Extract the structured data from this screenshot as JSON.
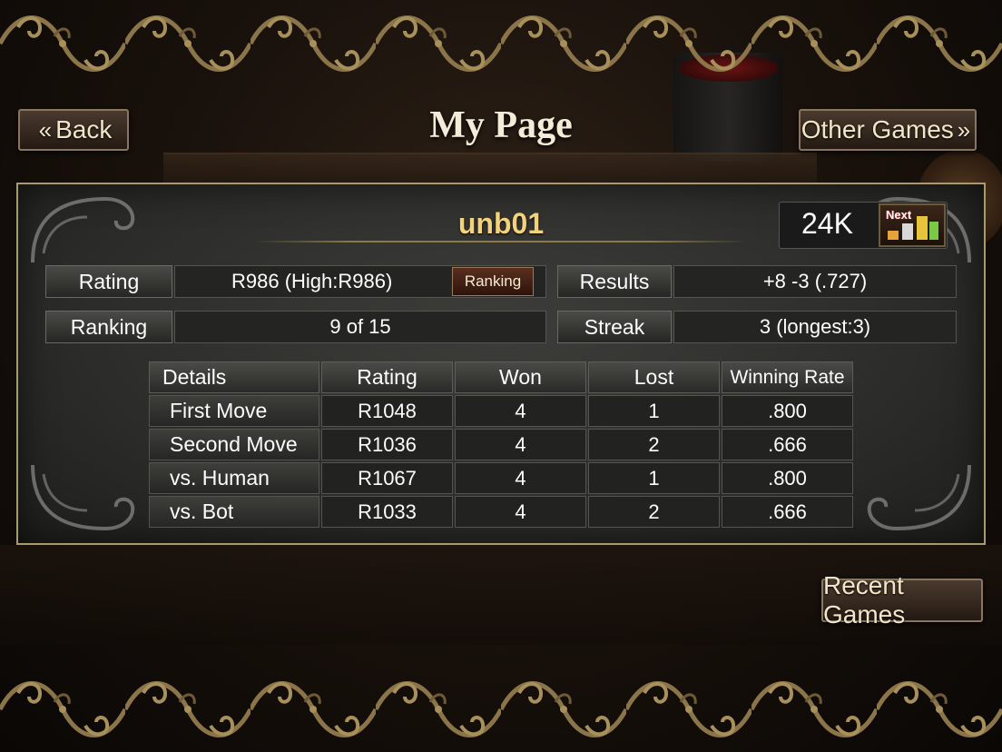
{
  "header": {
    "title": "My Page",
    "back_label": "Back",
    "other_games_label": "Other Games"
  },
  "profile": {
    "username": "unb01",
    "grade": "24K",
    "next_label": "Next"
  },
  "stats": {
    "rating_label": "Rating",
    "rating_value": "R986 (High:R986)",
    "ranking_button": "Ranking",
    "results_label": "Results",
    "results_value": "+8 -3 (.727)",
    "ranking_label": "Ranking",
    "ranking_value": "9 of 15",
    "streak_label": "Streak",
    "streak_value": "3 (longest:3)"
  },
  "details": {
    "headers": [
      "Details",
      "Rating",
      "Won",
      "Lost",
      "Winning Rate"
    ],
    "rows": [
      {
        "label": "First Move",
        "rating": "R1048",
        "won": "4",
        "lost": "1",
        "rate": ".800"
      },
      {
        "label": "Second Move",
        "rating": "R1036",
        "won": "4",
        "lost": "2",
        "rate": ".666"
      },
      {
        "label": "vs. Human",
        "rating": "R1067",
        "won": "4",
        "lost": "1",
        "rate": ".800"
      },
      {
        "label": "vs. Bot",
        "rating": "R1033",
        "won": "4",
        "lost": "2",
        "rate": ".666"
      }
    ]
  },
  "footer": {
    "recent_games_label": "Recent Games"
  },
  "colors": {
    "accent_gold": "#f2d27a",
    "panel_border": "#a89a6a",
    "button_red": "#5a2e1e"
  }
}
